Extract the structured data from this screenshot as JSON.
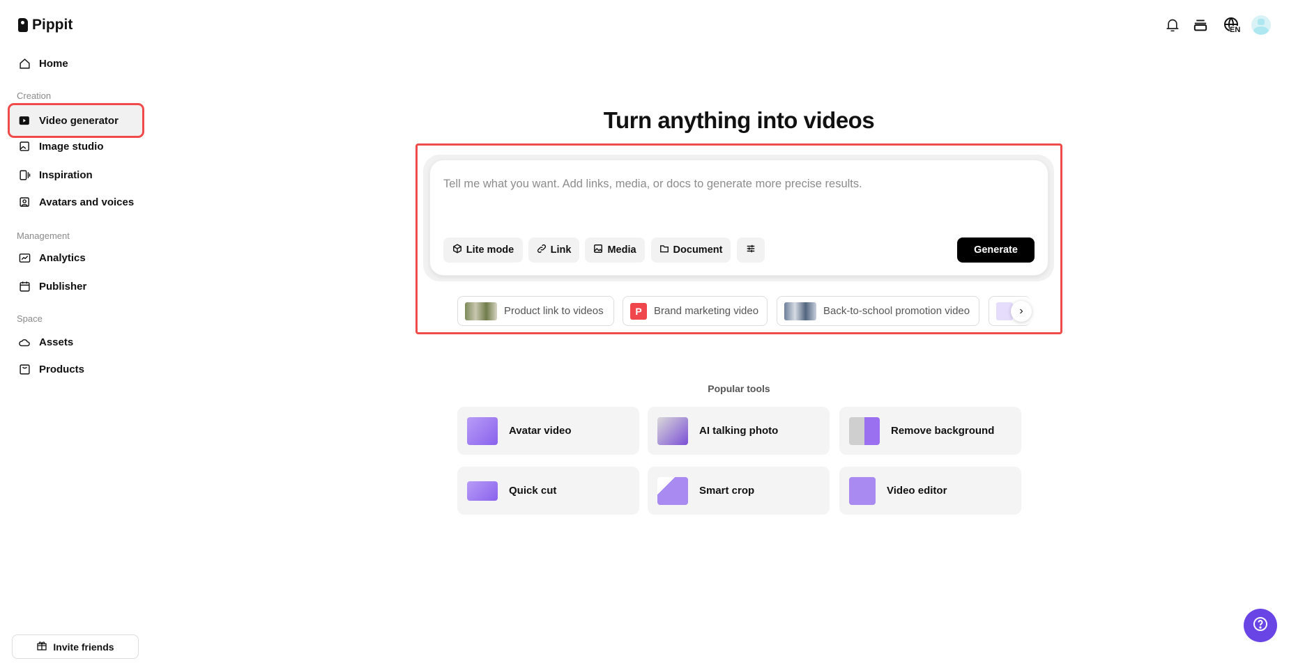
{
  "app": {
    "name": "Pippit"
  },
  "sidebar": {
    "home": "Home",
    "sections": {
      "creation": "Creation",
      "management": "Management",
      "space": "Space"
    },
    "items": {
      "video_generator": "Video generator",
      "image_studio": "Image studio",
      "inspiration": "Inspiration",
      "avatars": "Avatars and voices",
      "analytics": "Analytics",
      "publisher": "Publisher",
      "assets": "Assets",
      "products": "Products"
    },
    "invite": "Invite friends"
  },
  "header": {
    "language": "EN"
  },
  "main": {
    "title": "Turn anything into videos",
    "prompt_placeholder": "Tell me what you want. Add links, media, or docs to generate more precise results.",
    "toolbar": {
      "lite_mode": "Lite mode",
      "link": "Link",
      "media": "Media",
      "document": "Document",
      "generate": "Generate"
    },
    "suggestions": [
      "Product link to videos",
      "Brand marketing video",
      "Back-to-school promotion video"
    ],
    "brand_chip_letter": "P",
    "popular_title": "Popular tools",
    "tools": [
      "Avatar video",
      "AI talking photo",
      "Remove background",
      "Quick cut",
      "Smart crop",
      "Video editor"
    ]
  },
  "colors": {
    "accent": "#6a45e6",
    "highlight": "#f04a4a"
  }
}
